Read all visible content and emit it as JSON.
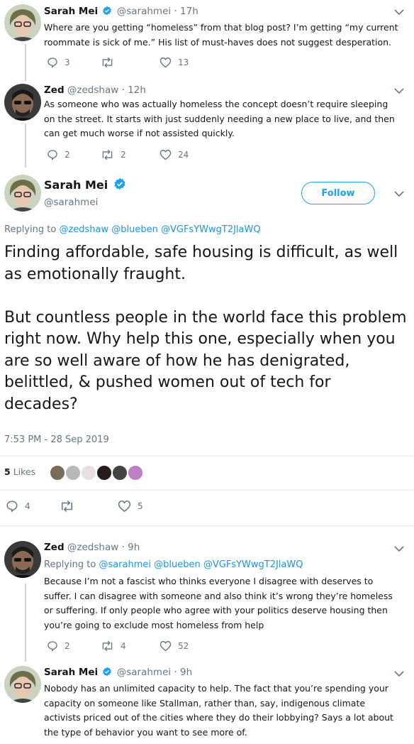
{
  "tweet1": {
    "name": "Sarah Mei",
    "handle": "@sarahmei",
    "dot": "·",
    "time": "17h",
    "text": "Where are you getting “homeless” from that blog post? I’m getting “my current roommate is sick of me.” His list of must-haves does not suggest desperation.",
    "replies": "3",
    "retweets": "",
    "likes": "13"
  },
  "tweet2": {
    "name": "Zed",
    "handle": "@zedshaw",
    "dot": "·",
    "time": "12h",
    "text": "As someone who was actually homeless the concept doesn’t require sleeping on the street. It starts with just suddenly needing a new place to live, and then can get much worse if not assisted quickly.",
    "replies": "2",
    "retweets": "2",
    "likes": "24"
  },
  "main": {
    "name": "Sarah Mei",
    "handle": "@sarahmei",
    "follow_label": "Follow",
    "replying_prefix": "Replying to",
    "replying_mentions": "@zedshaw @blueben @VGFsYWwgT2JlaWQ",
    "paragraph1": "Finding affordable, safe housing is difficult, as well as emotionally fraught.",
    "paragraph2": "But countless people in the world face this problem right now. Why help this one, especially when you are so well aware of how he has denigrated, belittled, & pushed women out of tech for decades?",
    "timestamp": "7:53 PM - 28 Sep 2019",
    "likes_number": "5",
    "likes_word": "Likes",
    "replies": "4",
    "retweets": "",
    "likes": "5"
  },
  "tweet3": {
    "name": "Zed",
    "handle": "@zedshaw",
    "dot": "·",
    "time": "9h",
    "replying_prefix": "Replying to",
    "replying_mentions": "@sarahmei @blueben @VGFsYWwgT2JlaWQ",
    "text": "Because I’m not a fascist who thinks everyone I disagree with deserves to suffer. I can disagree with someone and also think it’s wrong they’re homeless or suffering. If only people who agree with your politics deserve housing then you’re going to exclude  most homeless from help",
    "replies": "2",
    "retweets": "4",
    "likes": "52"
  },
  "tweet4": {
    "name": "Sarah Mei",
    "handle": "@sarahmei",
    "dot": "·",
    "time": "9h",
    "text": "Nobody has an unlimited capacity to help. The fact that you’re spending your capacity on someone like Stallman, rather than, say, indigenous climate activists priced out of the cities where they do their lobbying? Says a lot about the type of behavior you want to see more of."
  },
  "colors": {
    "accent": "#1da1f2",
    "link": "#1b95e0",
    "muted": "#657786",
    "text": "#14171a",
    "verified": "#1da1f2"
  },
  "icons": [
    "reply-icon",
    "retweet-icon",
    "like-icon",
    "chevron-down-icon",
    "verified-badge-icon"
  ]
}
